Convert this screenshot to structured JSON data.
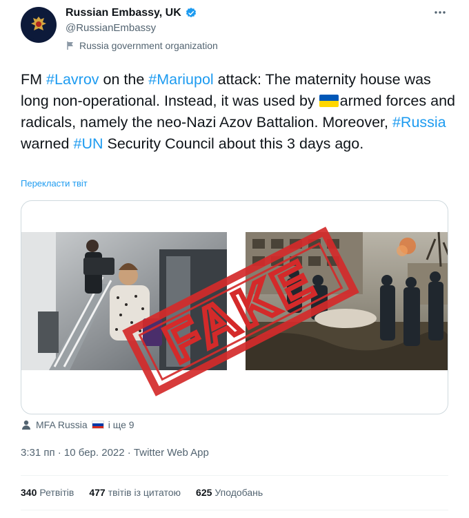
{
  "account": {
    "display_name": "Russian Embassy, UK",
    "handle": "@RussianEmbassy",
    "org_label": "Russia government organization",
    "verified_icon": "verified-badge-icon",
    "more_icon": "more-options-icon"
  },
  "tweet": {
    "parts": {
      "p1": "FM ",
      "tag_lavrov": "#Lavrov",
      "p2": " on the ",
      "tag_mariupol": "#Mariupol",
      "p3": " attack: The maternity house was long non-operational. Instead, it was used by ",
      "p4": "armed forces and radicals, namely the neo-Nazi Azov Battalion. Moreover, ",
      "tag_russia": "#Russia",
      "p5": " warned ",
      "tag_un": "#UN",
      "p6": " Security Council about this 3 days ago."
    },
    "translate_label": "Перекласти твіт"
  },
  "media": {
    "stamp_text": "FAKE",
    "stamp_color": "#d42a2a"
  },
  "tagged": {
    "label": "MFA Russia",
    "more": "і ще 9"
  },
  "meta": {
    "timestamp": "3:31 пп · 10 бер. 2022 · Twitter Web App"
  },
  "stats": {
    "retweets_count": "340",
    "retweets_label": "Ретвітів",
    "quotes_count": "477",
    "quotes_label": "твітів із цитатою",
    "likes_count": "625",
    "likes_label": "Уподобань"
  },
  "colors": {
    "link": "#1d9bf0",
    "secondary_text": "#536471",
    "primary_text": "#0f1419"
  }
}
